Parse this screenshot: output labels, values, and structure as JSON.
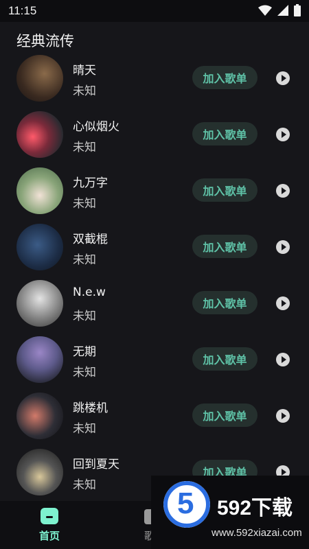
{
  "status_bar": {
    "time": "11:15"
  },
  "section": {
    "title": "经典流传"
  },
  "songs": [
    {
      "title": "晴天",
      "artist": "未知",
      "add_label": "加入歌单"
    },
    {
      "title": "心似烟火",
      "artist": "未知",
      "add_label": "加入歌单"
    },
    {
      "title": "九万字",
      "artist": "未知",
      "add_label": "加入歌单"
    },
    {
      "title": "双截棍",
      "artist": "未知",
      "add_label": "加入歌单"
    },
    {
      "title": "N.e.w",
      "artist": "未知",
      "add_label": "加入歌单"
    },
    {
      "title": "无期",
      "artist": "未知",
      "add_label": "加入歌单"
    },
    {
      "title": "跳楼机",
      "artist": "未知",
      "add_label": "加入歌单"
    },
    {
      "title": "回到夏天",
      "artist": "未知",
      "add_label": "加入歌单"
    }
  ],
  "bottom_nav": {
    "home_label": "首页",
    "song_label": "歌"
  },
  "watermark": {
    "brand": "592下载",
    "url": "www.592xiazai.com",
    "badge": "5"
  },
  "colors": {
    "accent": "#5fc2a7",
    "nav_active": "#7ef2cf",
    "background": "#16161a"
  }
}
